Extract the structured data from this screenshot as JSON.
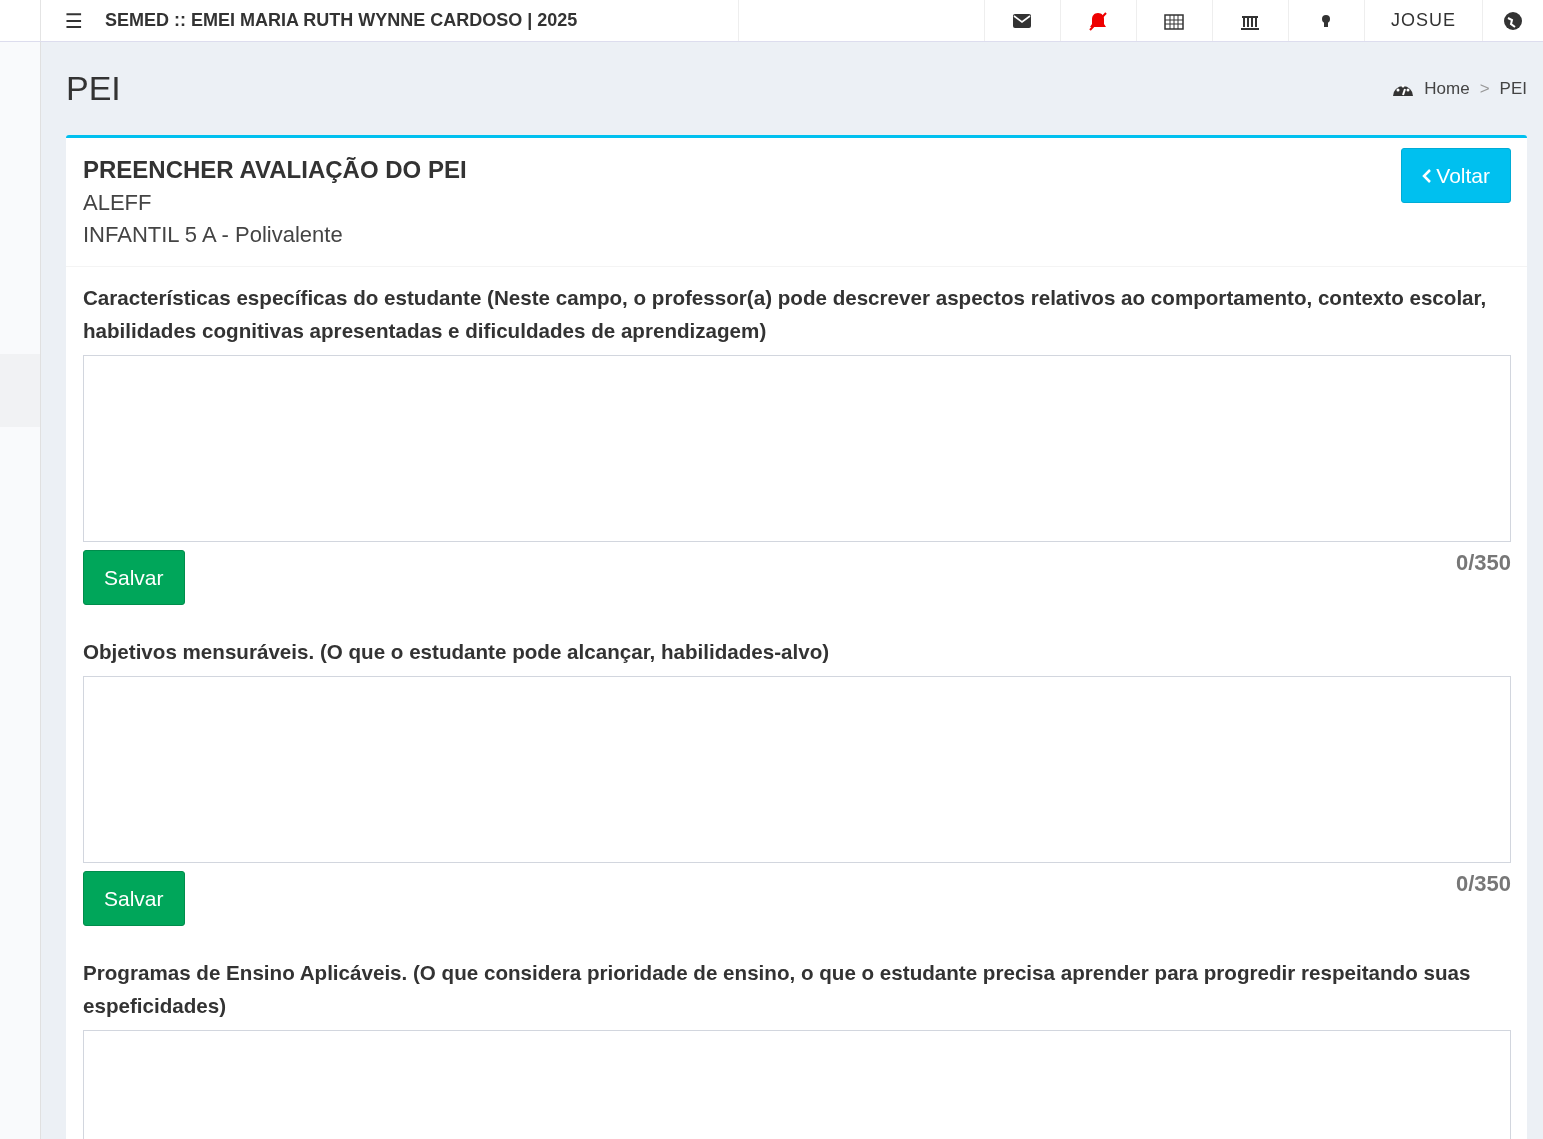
{
  "header": {
    "menu_icon": "☰",
    "title": "SEMED :: EMEI MARIA RUTH WYNNE CARDOSO | 2025",
    "icons": [
      {
        "kind": "mail"
      },
      {
        "kind": "bell-off"
      },
      {
        "kind": "calendar"
      },
      {
        "kind": "bank"
      },
      {
        "kind": "bulb"
      }
    ],
    "user": "JOSUE"
  },
  "page": {
    "title": "PEI",
    "breadcrumb": [
      {
        "label": "Home"
      },
      {
        "label": "PEI"
      }
    ],
    "separator": ">"
  },
  "card": {
    "title": "PREENCHER AVALIAÇÃO DO PEI",
    "student": "ALEFF",
    "class": "INFANTIL 5 A - Polivalente",
    "back_button": "Voltar",
    "fields": [
      {
        "label": "Características específicas do estudante (Neste campo, o professor(a) pode descrever aspectos relativos ao comportamento, contexto escolar, habilidades cognitivas apresentadas e dificuldades de aprendizagem)",
        "counter": "0/350",
        "button": "Salvar"
      },
      {
        "label": "Objetivos mensuráveis. (O que o estudante pode alcançar, habilidades-alvo)",
        "counter": "0/350",
        "button": "Salvar"
      },
      {
        "label": "Programas de Ensino Aplicáveis. (O que considera prioridade de ensino, o que o estudante precisa aprender para progredir respeitando suas espeficidades)"
      }
    ]
  }
}
